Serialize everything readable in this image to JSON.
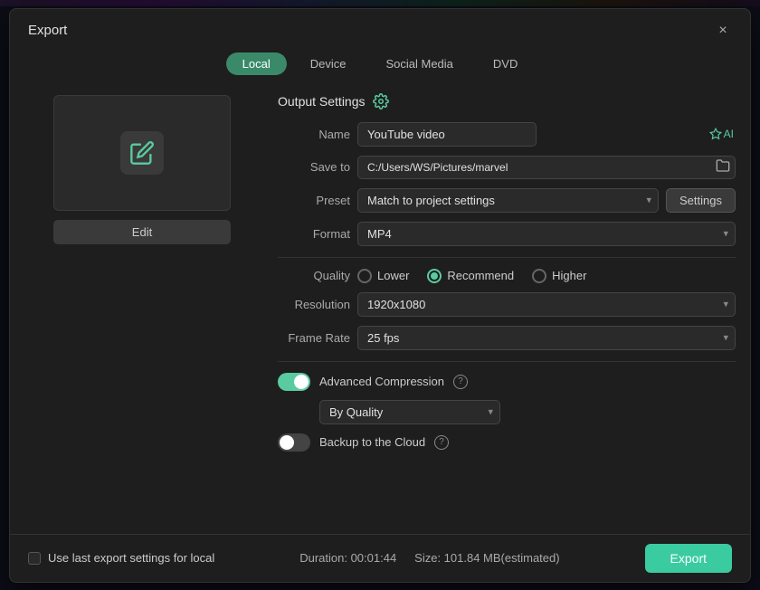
{
  "dialog": {
    "title": "Export",
    "close_label": "×"
  },
  "tabs": [
    {
      "id": "local",
      "label": "Local",
      "active": true
    },
    {
      "id": "device",
      "label": "Device",
      "active": false
    },
    {
      "id": "social-media",
      "label": "Social Media",
      "active": false
    },
    {
      "id": "dvd",
      "label": "DVD",
      "active": false
    }
  ],
  "preview": {
    "edit_button_label": "Edit"
  },
  "output_settings": {
    "header": "Output Settings",
    "name_label": "Name",
    "name_value": "YouTube video",
    "ai_label": "AI",
    "save_to_label": "Save to",
    "save_to_path": "C:/Users/WS/Pictures/marvel",
    "preset_label": "Preset",
    "preset_value": "Match to project settings",
    "settings_button_label": "Settings",
    "format_label": "Format",
    "format_value": "MP4",
    "quality_label": "Quality",
    "quality_options": [
      {
        "id": "lower",
        "label": "Lower",
        "selected": false
      },
      {
        "id": "recommend",
        "label": "Recommend",
        "selected": true
      },
      {
        "id": "higher",
        "label": "Higher",
        "selected": false
      }
    ],
    "resolution_label": "Resolution",
    "resolution_value": "1920x1080",
    "frame_rate_label": "Frame Rate",
    "frame_rate_value": "25 fps",
    "advanced_compression_label": "Advanced Compression",
    "advanced_compression_on": true,
    "by_quality_label": "By Quality",
    "backup_cloud_label": "Backup to the Cloud",
    "backup_cloud_on": false
  },
  "footer": {
    "use_last_settings_label": "Use last export settings for local",
    "duration_label": "Duration: 00:01:44",
    "size_label": "Size: 101.84 MB(estimated)",
    "export_label": "Export"
  }
}
